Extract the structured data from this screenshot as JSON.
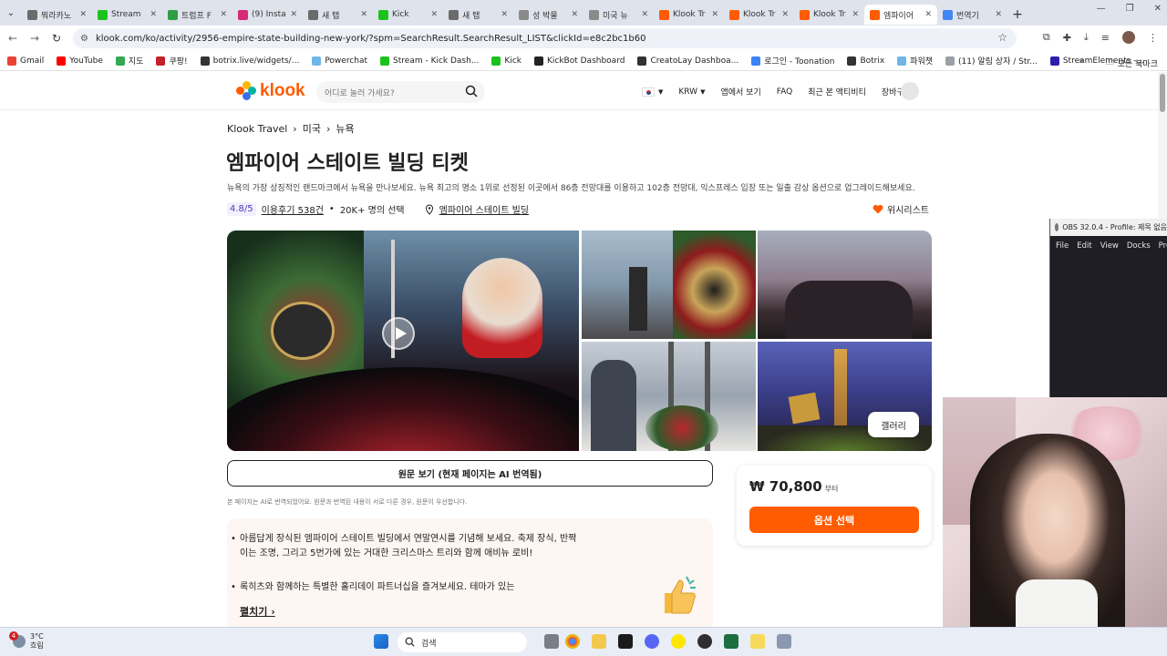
{
  "browser": {
    "tabs": [
      {
        "title": "뭐라카노",
        "color": "#6b6b6b",
        "icon": "globe-icon"
      },
      {
        "title": "Stream",
        "color": "#1cc21c",
        "icon": "kick-icon"
      },
      {
        "title": "트럼프 F",
        "color": "#2f9e44",
        "icon": "maps-pin-icon"
      },
      {
        "title": "(9) Insta",
        "color": "#d62976",
        "icon": "instagram-icon"
      },
      {
        "title": "새 탭",
        "color": "#6b6b6b",
        "icon": "globe-icon"
      },
      {
        "title": "Kick",
        "color": "#1cc21c",
        "icon": "kick-icon"
      },
      {
        "title": "새 탭",
        "color": "#6b6b6b",
        "icon": "globe-icon"
      },
      {
        "title": "성 박물",
        "color": "#8a8a8a",
        "icon": "museum-icon"
      },
      {
        "title": "미국 뉴",
        "color": "#8a8a8a",
        "icon": "museum-icon"
      },
      {
        "title": "Klook Tr",
        "color": "#ff5b00",
        "icon": "klook-icon"
      },
      {
        "title": "Klook Tr",
        "color": "#ff5b00",
        "icon": "klook-icon"
      },
      {
        "title": "Klook Tr",
        "color": "#ff5b00",
        "icon": "klook-icon"
      },
      {
        "title": "엠파이어",
        "color": "#ff5b00",
        "icon": "klook-icon"
      },
      {
        "title": "번역기",
        "color": "#4285f4",
        "icon": "google-icon"
      }
    ],
    "active_tab_index": 12,
    "url": "klook.com/ko/activity/2956-empire-state-building-new-york/?spm=SearchResult.SearchResult_LIST&clickId=e8c2bc1b60",
    "bookmarks": [
      {
        "label": "Gmail",
        "color": "#ea4335"
      },
      {
        "label": "YouTube",
        "color": "#ff0000"
      },
      {
        "label": "지도",
        "color": "#34a853"
      },
      {
        "label": "쿠팡!",
        "color": "#c4202a"
      },
      {
        "label": "botrix.live/widgets/...",
        "color": "#333333"
      },
      {
        "label": "Powerchat",
        "color": "#6fb6e8"
      },
      {
        "label": "Stream - Kick Dash...",
        "color": "#1cc21c"
      },
      {
        "label": "Kick",
        "color": "#1cc21c"
      },
      {
        "label": "KickBot Dashboard",
        "color": "#222222"
      },
      {
        "label": "CreatoLay Dashboa...",
        "color": "#333333"
      },
      {
        "label": "로그인 - Toonation",
        "color": "#3b82f6"
      },
      {
        "label": "Botrix",
        "color": "#333333"
      },
      {
        "label": "파워챗",
        "color": "#6fb6e8"
      },
      {
        "label": "(11) 알림 상자 / Str...",
        "color": "#9aa0a6"
      },
      {
        "label": "StreamElements -...",
        "color": "#2f1fa8"
      }
    ],
    "all_bookmarks_label": "모든 북마크"
  },
  "site": {
    "logo_text": "klook",
    "search_placeholder": "어디로 놀러 가세요?",
    "currency": "KRW",
    "nav": {
      "app": "앱에서 보기",
      "faq": "FAQ",
      "recent": "최근 본 액티비티",
      "cart": "장바구니"
    }
  },
  "activity": {
    "breadcrumb": [
      "Klook Travel",
      "미국",
      "뉴욕"
    ],
    "title": "엠파이어 스테이트 빌딩 티켓",
    "subtitle": "뉴욕의 가장 상징적인 랜드마크에서 뉴욕을 만나보세요. 뉴욕 최고의 명소 1위로 선정된 이곳에서 86층 전망대를 이용하고 102층 전망대, 익스프레스 입장 또는 일출 감상 옵션으로 업그레이드해보세요.",
    "rating": "4.8/5",
    "reviews": "이용후기 538건",
    "booked": "20K+ 명의 선택",
    "location": "엠파이어 스테이트 빌딩",
    "wishlist": "위시리스트",
    "gallery_label": "갤러리",
    "original_btn": "원문 보기 (현재 페이지는 AI 번역됨)",
    "ai_note": "본 페이지는 AI로 번역되었어요. 원문과 번역된 내용이 서로 다른 경우, 원문이 우선합니다.",
    "highlights": [
      "아름답게 장식된 엠파이어 스테이트 빌딩에서 연말연시를 기념해 보세요. 축제 장식, 반짝이는 조명, 그리고 5번가에 있는 거대한 크리스마스 트리와 함께 애비뉴 로비!",
      "록히츠와 함께하는 특별한 홀리데이 파트너십을 즐겨보세요. 테마가 있는"
    ],
    "expand_label": "펼치기",
    "price": "₩ 70,800",
    "price_suffix": "부터",
    "select_btn": "옵션 선택",
    "accent": "#ff5b00"
  },
  "obs": {
    "title": "OBS 32.0.4 - Profile: 제목 없음",
    "menu": [
      "File",
      "Edit",
      "View",
      "Docks",
      "Pro"
    ]
  },
  "taskbar": {
    "weather_temp": "3°C",
    "weather_desc": "흐림",
    "notif_count": "4",
    "search_label": "검색"
  }
}
